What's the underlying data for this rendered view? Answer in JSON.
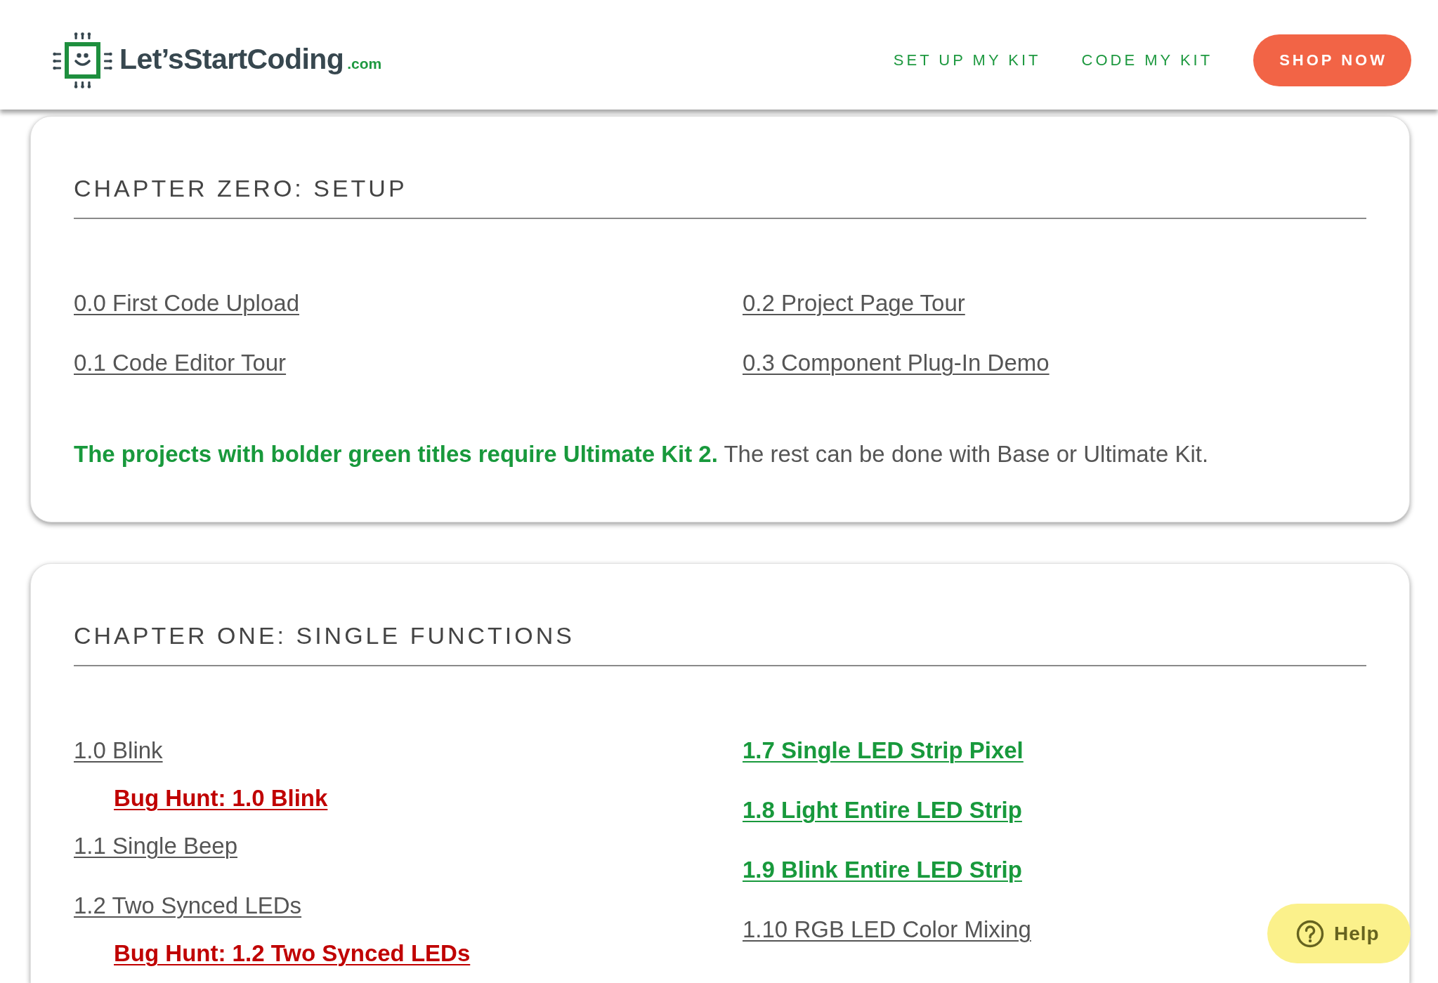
{
  "header": {
    "logo": {
      "name": "Let’sStartCoding",
      "domain": ".com"
    },
    "nav": [
      {
        "label": "SET UP MY KIT"
      },
      {
        "label": "CODE MY KIT"
      }
    ],
    "cta": {
      "label": "SHOP NOW"
    }
  },
  "chapters": [
    {
      "title": "CHAPTER ZERO: SETUP",
      "columns": [
        [
          {
            "label": "0.0 First Code Upload",
            "kind": "standard"
          },
          {
            "label": "0.1 Code Editor Tour",
            "kind": "standard"
          }
        ],
        [
          {
            "label": "0.2 Project Page Tour",
            "kind": "standard"
          },
          {
            "label": "0.3 Component Plug-In Demo",
            "kind": "standard"
          }
        ]
      ],
      "note": "**The projects with bolder green titles require Ultimate Kit 2.** The rest can be done with Base or Ultimate Kit."
    },
    {
      "title": "CHAPTER ONE: SINGLE FUNCTIONS",
      "columns": [
        [
          {
            "label": "1.0 Blink",
            "kind": "standard",
            "children": [
              {
                "label": "Bug Hunt: 1.0 Blink",
                "kind": "bug_hunt"
              }
            ]
          },
          {
            "label": "1.1 Single Beep",
            "kind": "standard"
          },
          {
            "label": "1.2 Two Synced LEDs",
            "kind": "standard",
            "children": [
              {
                "label": "Bug Hunt: 1.2 Two Synced LEDs",
                "kind": "bug_hunt"
              }
            ]
          }
        ],
        [
          {
            "label": "1.7 Single LED Strip Pixel",
            "kind": "ultimate_kit_2"
          },
          {
            "label": "1.8 Light Entire LED Strip",
            "kind": "ultimate_kit_2"
          },
          {
            "label": "1.9 Blink Entire LED Strip",
            "kind": "ultimate_kit_2"
          },
          {
            "label": "1.10 RGB LED Color Mixing",
            "kind": "standard"
          }
        ]
      ]
    }
  ],
  "help_button": {
    "label": "Help"
  }
}
